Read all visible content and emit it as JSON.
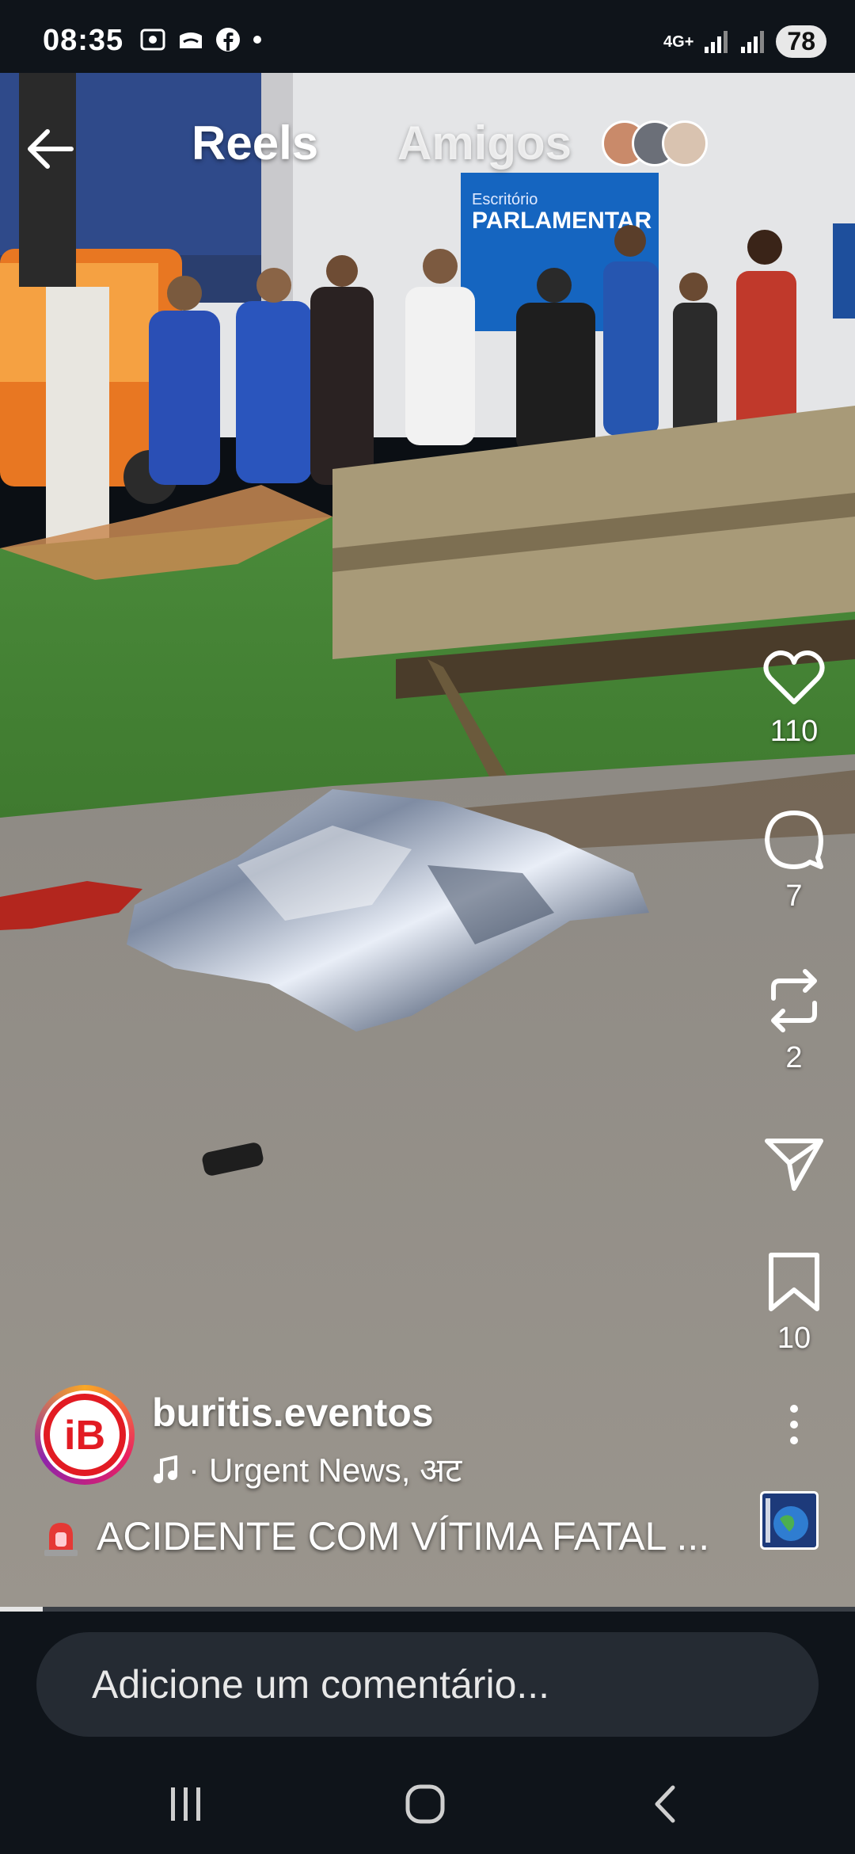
{
  "status_bar": {
    "time": "08:35",
    "network": "4G+",
    "battery": "78",
    "left_icons": [
      "screenshot-icon",
      "cast-icon",
      "facebook-icon",
      "dot-icon"
    ]
  },
  "header": {
    "back_icon": "arrow-left-icon",
    "tab_reels": "Reels",
    "tab_friends": "Amigos"
  },
  "actions": {
    "likes": "110",
    "comments": "7",
    "reposts": "2",
    "saves": "10"
  },
  "post": {
    "username": "buritis.eventos",
    "audio": "Urgent News, अट",
    "caption": "ACIDENTE COM VÍTIMA FATAL ...",
    "caption_icon": "siren-emoji",
    "avatar_letters": "iB"
  },
  "scene_text": {
    "sign_small": "Escritório",
    "sign_big": "PARLAMENTAR"
  },
  "progress": {
    "fraction": 0.05
  },
  "comment": {
    "placeholder": "Adicione um comentário..."
  },
  "nav": {
    "recents_icon": "recents-icon",
    "home_icon": "home-icon",
    "back_icon": "back-icon"
  },
  "colors": {
    "background": "#0f141a",
    "input_bg": "#252b33",
    "sign_blue": "#1565c0"
  }
}
